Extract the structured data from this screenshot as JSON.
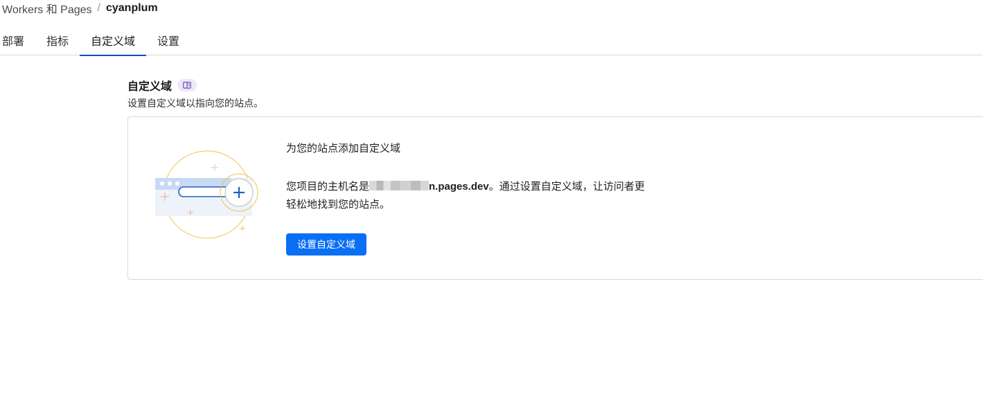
{
  "breadcrumb": {
    "parent": "Workers 和 Pages",
    "separator": "/",
    "current": "cyanplum"
  },
  "tabs": [
    {
      "label": "部署"
    },
    {
      "label": "指标"
    },
    {
      "label": "自定义域",
      "active": true
    },
    {
      "label": "设置"
    }
  ],
  "section": {
    "title": "自定义域",
    "docs_icon": "book-icon",
    "description": "设置自定义域以指向您的站点。"
  },
  "card": {
    "heading": "为您的站点添加自定义域",
    "text_before": "您项目的主机名是",
    "host_suffix": "n.pages.dev",
    "text_after": "。通过设置自定义域，让访问者更轻松地找到您的站点。",
    "button_label": "设置自定义域",
    "illustration_icon": "add-domain-illustration"
  },
  "colors": {
    "accent": "#0051c3",
    "button": "#0a6ff5",
    "illustration_ring": "#f0c24b",
    "docs_pill_bg": "#ede7f6"
  }
}
